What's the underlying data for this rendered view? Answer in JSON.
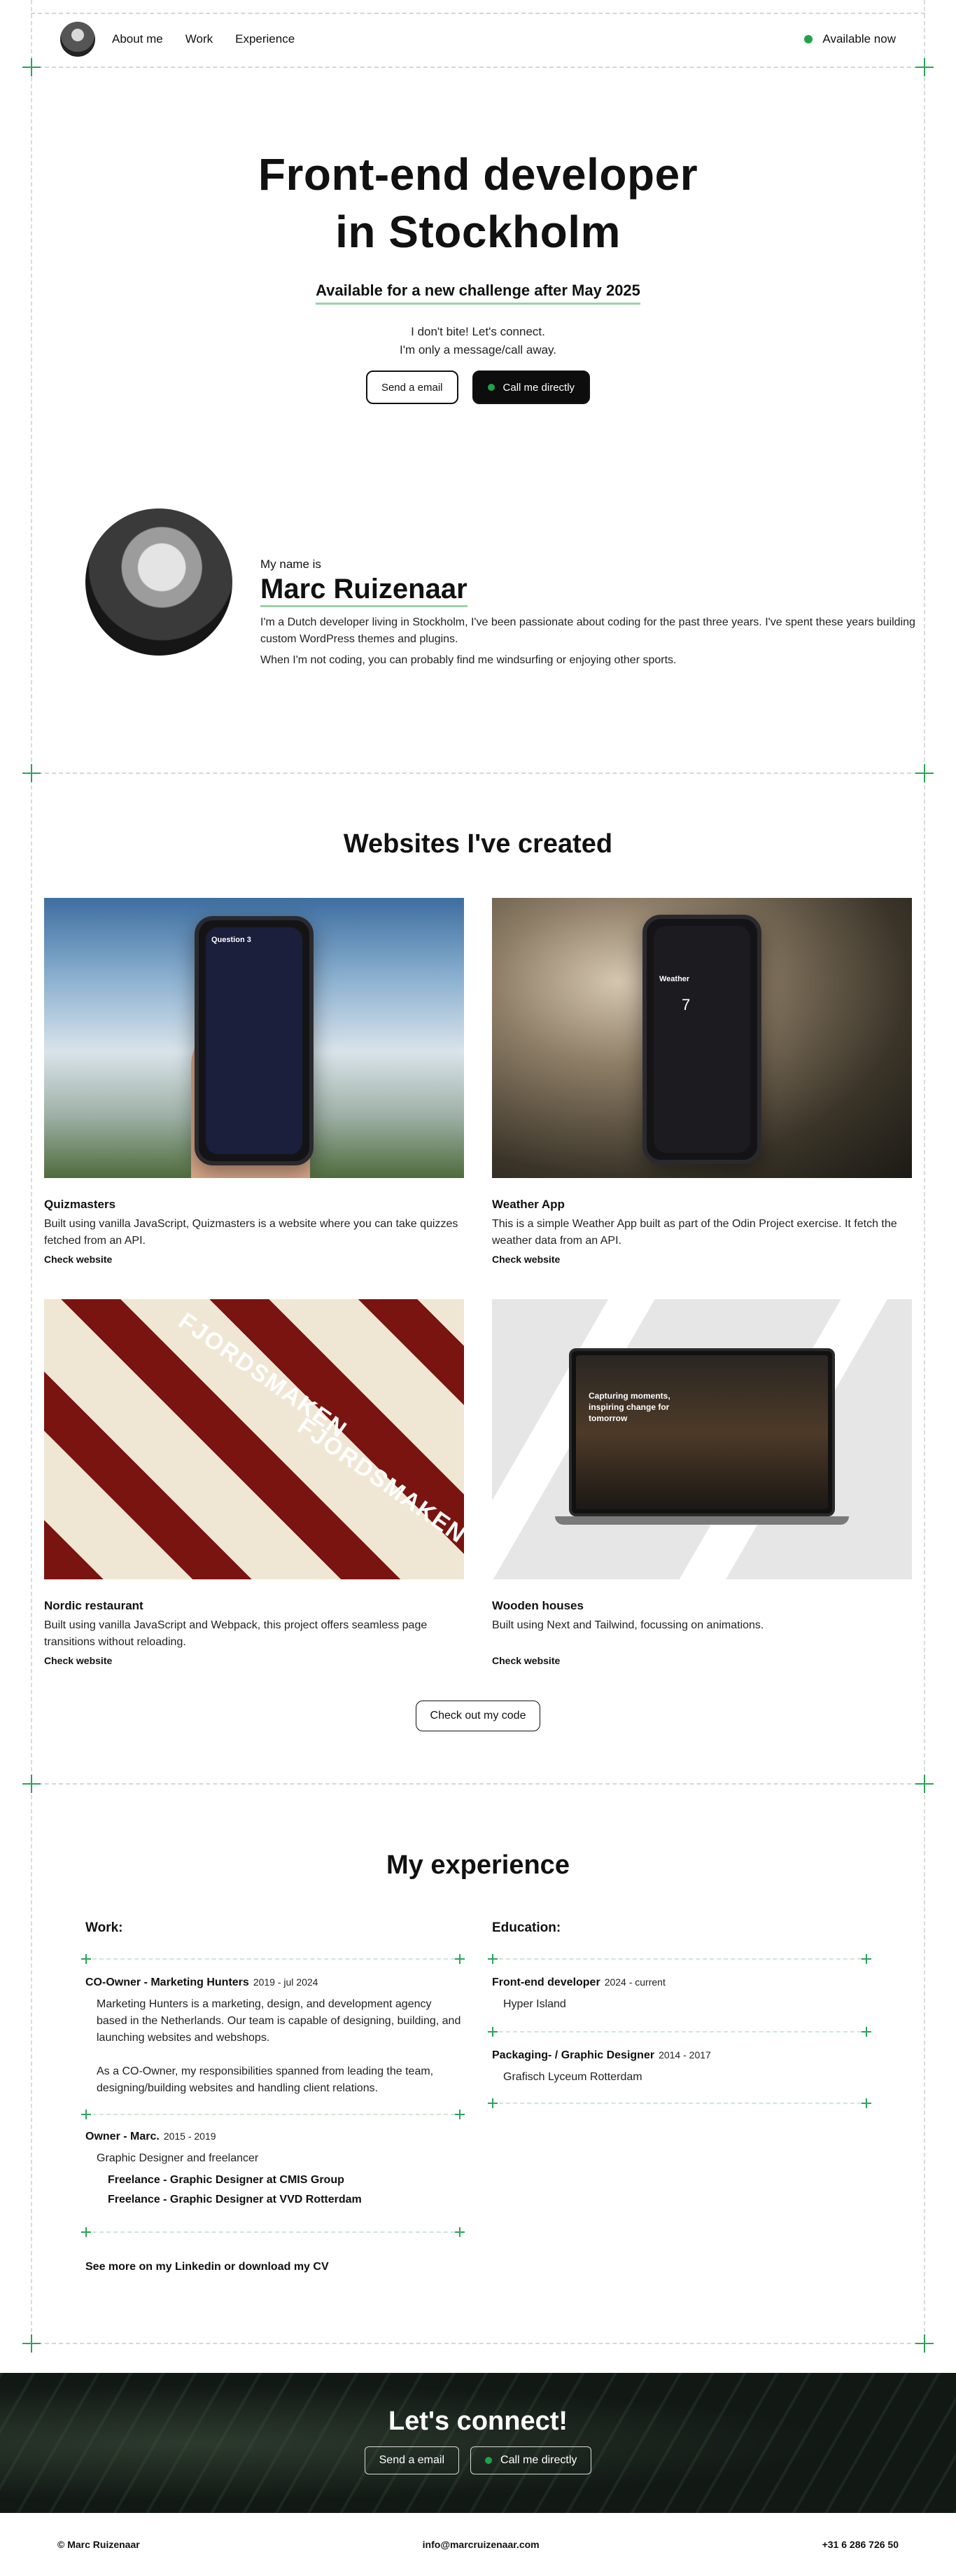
{
  "nav": {
    "links": [
      "About me",
      "Work",
      "Experience"
    ],
    "status": "Available now",
    "status_color": "#1fa34a"
  },
  "hero": {
    "title_line1": "Front-end developer",
    "title_line2": "in Stockholm",
    "subtitle": "Available for a new challenge after May 2025",
    "note_line1": "I don't bite! Let's connect.",
    "note_line2": "I'm only a message/call away.",
    "email_button": "Send a email",
    "call_button": "Call me directly"
  },
  "about": {
    "intro": "My name is",
    "name": "Marc Ruizenaar",
    "para1": "I'm a Dutch developer living in Stockholm, I've been passionate about coding for the past three years. I've spent these years building custom WordPress themes and plugins.",
    "para2": "When I'm not coding, you can probably find me windsurfing or enjoying other sports."
  },
  "projects": {
    "title": "Websites I've created",
    "items": [
      {
        "name": "Quizmasters",
        "desc": "Built using vanilla JavaScript, Quizmasters is a website where you can take quizzes fetched from an API.",
        "link": "Check website"
      },
      {
        "name": "Weather App",
        "desc": "This is a simple Weather App built as part of the Odin Project exercise. It fetch the weather data from an API.",
        "link": "Check website"
      },
      {
        "name": "Nordic restaurant",
        "desc": "Built using vanilla JavaScript and Webpack, this project offers seamless page transitions without reloading.",
        "link": "Check website"
      },
      {
        "name": "Wooden houses",
        "desc": "Built using Next and Tailwind, focussing on animations.",
        "link": "Check website"
      }
    ],
    "more_button": "Check out my code",
    "quiz_screen_title": "Question 3",
    "weather_screen_title": "Weather",
    "weather_temp": "7",
    "restaurant_label": "FJORDSMAKEN",
    "houses_headline": "Capturing moments, inspiring change for tomorrow"
  },
  "experience": {
    "title": "My experience",
    "work_heading": "Work:",
    "education_heading": "Education:",
    "work": [
      {
        "role": "CO-Owner - Marketing Hunters",
        "period": "2019 - jul 2024",
        "body": [
          "Marketing Hunters is a marketing, design, and development agency based in the Netherlands. Our team is capable of designing, building, and launching websites and webshops.",
          "As a CO-Owner, my responsibilities spanned from leading the team, designing/building websites and handling client relations."
        ]
      },
      {
        "role": "Owner - Marc.",
        "period": "2015 - 2019",
        "body": [
          "Graphic Designer and freelancer"
        ],
        "sub": [
          "Freelance - Graphic Designer at CMIS Group",
          "Freelance - Graphic Designer at VVD Rotterdam"
        ]
      }
    ],
    "education": [
      {
        "role": "Front-end developer",
        "period": "2024 - current",
        "place": "Hyper Island"
      },
      {
        "role": "Packaging- / Graphic Designer",
        "period": "2014 - 2017",
        "place": "Grafisch Lyceum Rotterdam"
      }
    ],
    "cv_link": "See more on my Linkedin or download my CV"
  },
  "connect": {
    "title": "Let's connect!",
    "email_button": "Send a email",
    "call_button": "Call me directly"
  },
  "footer": {
    "copyright": "© Marc Ruizenaar",
    "email": "info@marcruizenaar.com",
    "phone": "+31 6 286 726 50"
  },
  "colors": {
    "accent_green": "#2aa55a",
    "underline": "#9ad2a9",
    "dark": "#0d0d0d"
  }
}
